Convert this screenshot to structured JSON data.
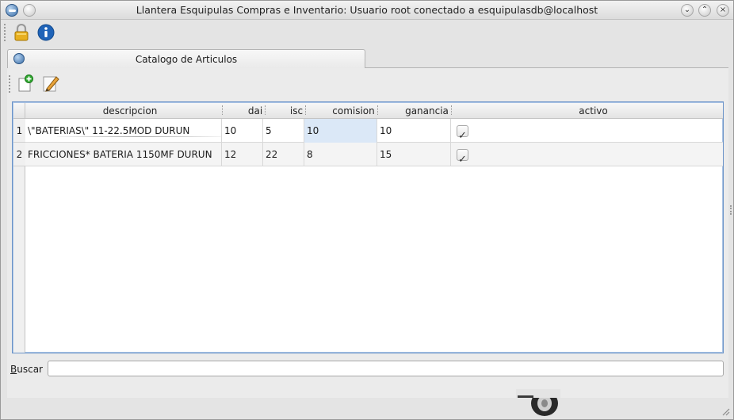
{
  "window": {
    "title": "Llantera Esquipulas Compras e Inventario: Usuario root conectado a esquipulasdb@localhost",
    "buttons": [
      "minimize",
      "maximize",
      "close"
    ]
  },
  "toolbar": {
    "icons": [
      "lock-icon",
      "info-icon"
    ]
  },
  "tab": {
    "label": "Catalogo de Articulos"
  },
  "actions": {
    "icons": [
      "new-document-icon",
      "edit-pencil-icon"
    ]
  },
  "table": {
    "columns": [
      "descripcion",
      "dai",
      "isc",
      "comision",
      "ganancia",
      "activo"
    ],
    "rows": [
      {
        "num": "1",
        "descripcion": "\\\"BATERIAS\\\" 11-22.5MOD DURUN",
        "dai": "10",
        "isc": "5",
        "comision": "10",
        "ganancia": "10",
        "activo": true
      },
      {
        "num": "2",
        "descripcion": "FRICCIONES* BATERIA  1150MF DURUN",
        "dai": "12",
        "isc": "22",
        "comision": "8",
        "ganancia": "15",
        "activo": true
      }
    ]
  },
  "search": {
    "label_underlined": "B",
    "label_rest": "uscar",
    "value": ""
  },
  "colors": {
    "selection": "#dbe8f7",
    "table_border": "#6a93c8",
    "app_icon": "#3a6ea8"
  }
}
